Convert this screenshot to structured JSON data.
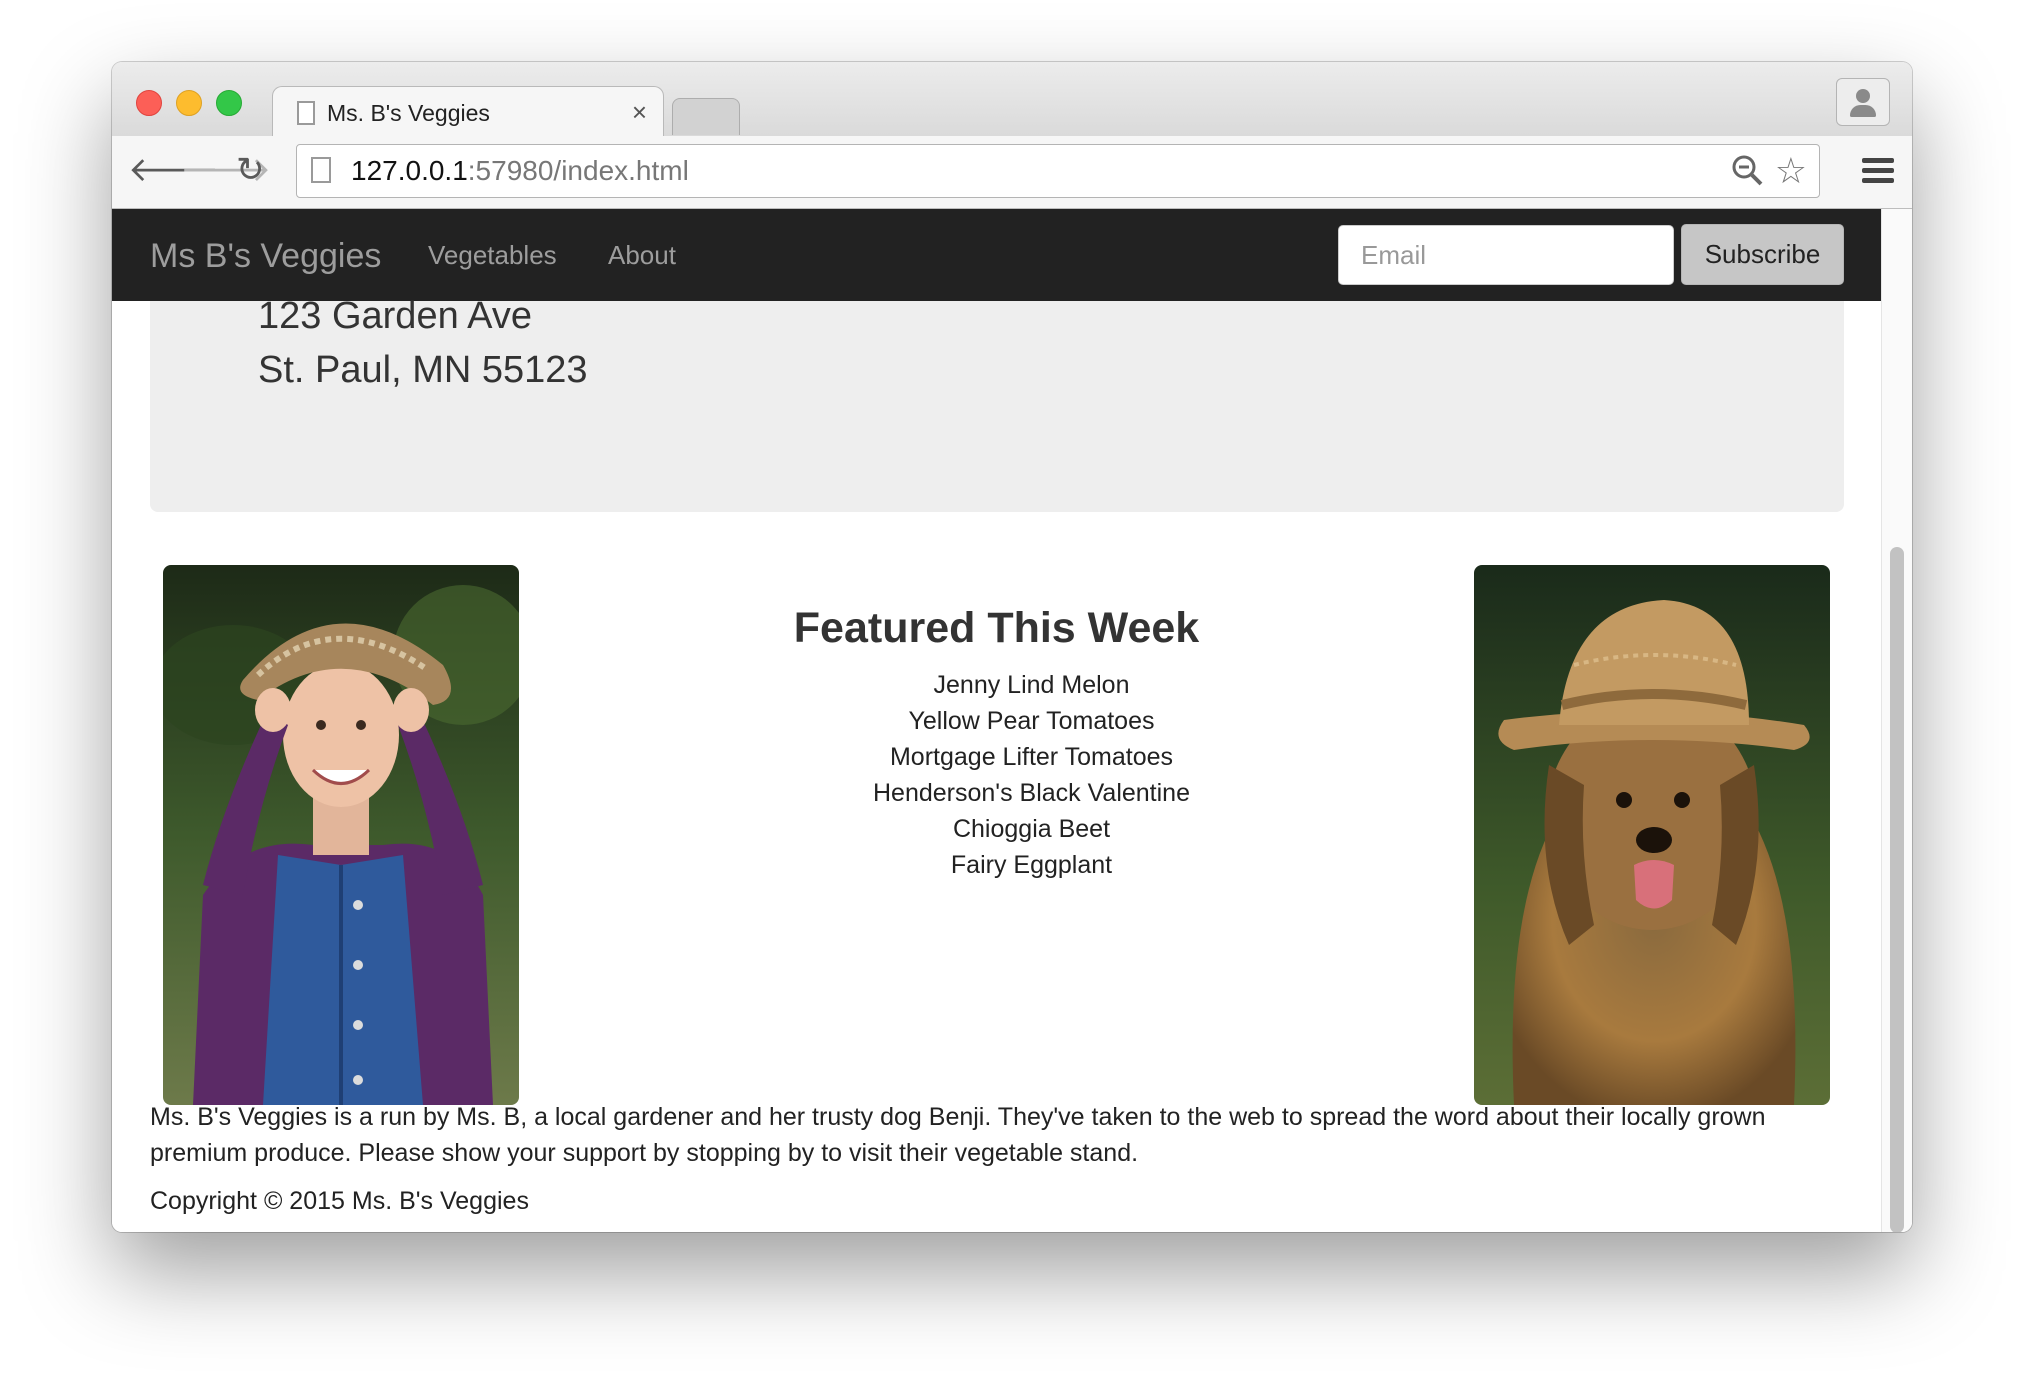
{
  "browser": {
    "tab_title": "Ms. B's Veggies",
    "tab_close": "×",
    "url_host": "127.0.0.1",
    "url_rest": ":57980/index.html",
    "icons": {
      "back": "back-arrow-icon",
      "forward": "forward-arrow-icon",
      "reload": "reload-icon",
      "zoom": "zoom-icon",
      "bookmark": "star-icon",
      "menu": "hamburger-menu-icon",
      "profile": "profile-icon"
    }
  },
  "navbar": {
    "brand": "Ms B's Veggies",
    "links": [
      "Vegetables",
      "About"
    ],
    "email_placeholder": "Email",
    "subscribe_label": "Subscribe",
    "background": "#222222"
  },
  "jumbotron": {
    "address_line1": "123 Garden Ave",
    "address_line2": "St. Paul, MN 55123"
  },
  "featured": {
    "title": "Featured This Week",
    "items": [
      "Jenny Lind Melon",
      "Yellow Pear Tomatoes",
      "Mortgage Lifter Tomatoes",
      "Henderson's Black Valentine",
      "Chioggia Beet",
      "Fairy Eggplant"
    ]
  },
  "about": {
    "description": "Ms. B's Veggies is a run by Ms. B, a local gardener and her trusty dog Benji. They've taken to the web to spread the word about their locally grown premium produce. Please show your support by stopping by to visit their vegetable stand.",
    "copyright": "Copyright © 2015 Ms. B's Veggies"
  }
}
